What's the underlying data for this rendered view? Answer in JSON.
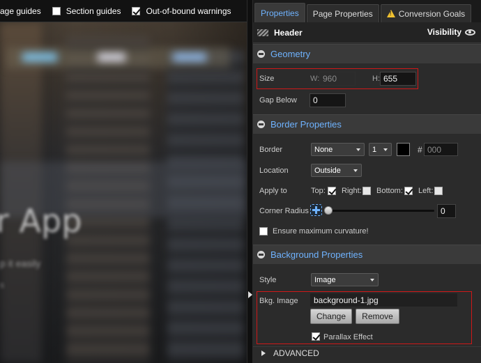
{
  "guides_bar": {
    "page_guides_label": "age guides",
    "section_guides_label": "Section guides",
    "out_of_bound_label": "Out-of-bound warnings",
    "section_guides_checked": false,
    "out_of_bound_checked": true
  },
  "preview": {
    "hero_title": "r App",
    "hero_subtitle": "p it easily",
    "hero_subtitle2": "s"
  },
  "tabs": [
    {
      "label": "Properties",
      "active": true
    },
    {
      "label": "Page Properties",
      "active": false
    },
    {
      "label": "Conversion Goals",
      "active": false,
      "icon": "warning-icon"
    }
  ],
  "header": {
    "title": "Header",
    "visibility_label": "Visibility"
  },
  "geometry": {
    "title": "Geometry",
    "size_label": "Size",
    "w_label": "W:",
    "w_value": "960",
    "h_label": "H:",
    "h_value": "655",
    "gap_label": "Gap Below",
    "gap_value": "0"
  },
  "border": {
    "title": "Border Properties",
    "border_label": "Border",
    "style_value": "None",
    "width_value": "1",
    "color_hash": "#",
    "color_value": "000",
    "swatch_color": "#000000",
    "location_label": "Location",
    "location_value": "Outside",
    "apply_label": "Apply to",
    "top_label": "Top:",
    "right_label": "Right:",
    "bottom_label": "Bottom:",
    "left_label": "Left:",
    "top_checked": true,
    "right_checked": false,
    "bottom_checked": true,
    "left_checked": false,
    "radius_label": "Corner Radius",
    "radius_value": "0",
    "radius_level": 0,
    "curvature_label": "Ensure maximum curvature!"
  },
  "background": {
    "title": "Background Properties",
    "style_label": "Style",
    "style_value": "Image",
    "image_label": "Bkg. Image",
    "image_value": "background-1.jpg",
    "change_label": "Change",
    "remove_label": "Remove",
    "parallax_label": "Parallax Effect",
    "parallax_checked": true
  },
  "advanced": {
    "label": "ADVANCED"
  },
  "colors": {
    "accent": "#6fb3ff",
    "highlight_border": "#d01818",
    "warning": "#f2c230"
  }
}
